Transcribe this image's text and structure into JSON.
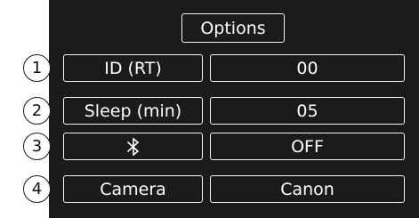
{
  "title": "Options",
  "rows": [
    {
      "index": "1",
      "label": "ID (RT)",
      "value": "00"
    },
    {
      "index": "2",
      "label": "Sleep (min)",
      "value": "05"
    },
    {
      "index": "3",
      "label": "",
      "icon": "bluetooth-icon",
      "value": "OFF"
    },
    {
      "index": "4",
      "label": "Camera",
      "value": "Canon"
    }
  ]
}
